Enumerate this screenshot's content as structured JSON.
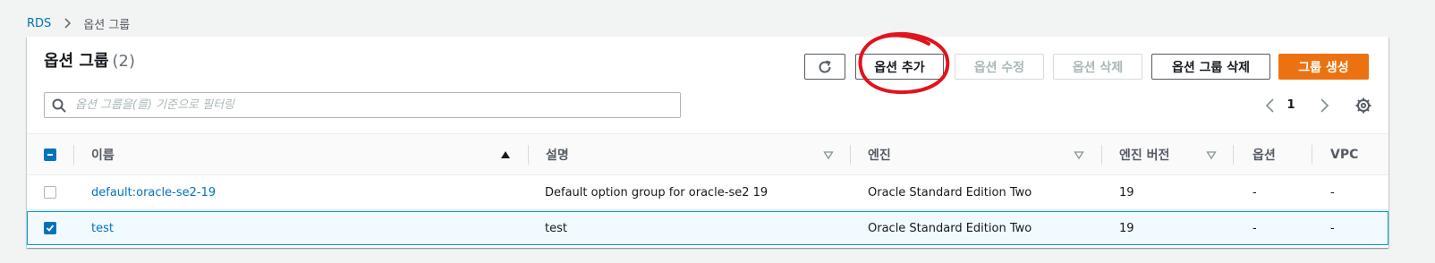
{
  "breadcrumb": {
    "root": "RDS",
    "current": "옵션 그룹"
  },
  "header": {
    "title": "옵션 그룹",
    "count": "(2)"
  },
  "toolbar": {
    "add_option": "옵션 추가",
    "modify_option": "옵션 수정",
    "delete_option": "옵션 삭제",
    "delete_group": "옵션 그룹 삭제",
    "create_group": "그룹 생성"
  },
  "search": {
    "placeholder": "옵션 그룹을(를) 기준으로 필터링",
    "value": ""
  },
  "pagination": {
    "current_page": "1"
  },
  "table": {
    "columns": [
      "이름",
      "설명",
      "엔진",
      "엔진 버전",
      "옵션",
      "VPC"
    ],
    "rows": [
      {
        "name": "default:oracle-se2-19",
        "description": "Default option group for oracle-se2 19",
        "engine": "Oracle Standard Edition Two",
        "version": "19",
        "options": "-",
        "vpc": "-",
        "selected": false
      },
      {
        "name": "test",
        "description": "test",
        "engine": "Oracle Standard Edition Two",
        "version": "19",
        "options": "-",
        "vpc": "-",
        "selected": true
      }
    ]
  },
  "colors": {
    "accent": "#0073bb",
    "primary_button": "#ec7211",
    "annotation": "#e0141e",
    "selected_row_border": "#00a1c9"
  },
  "icons": [
    "chevron-right-icon",
    "refresh-icon",
    "search-icon",
    "chevron-left-icon",
    "chevron-right-icon",
    "gear-icon",
    "sort-ascending-icon",
    "sort-icon",
    "checkbox-indeterminate-icon",
    "checkmark-icon"
  ]
}
